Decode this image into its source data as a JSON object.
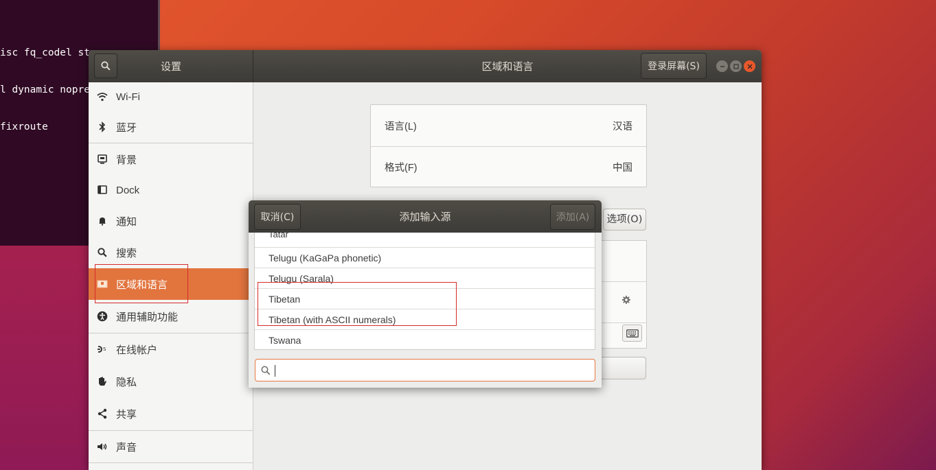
{
  "terminal": {
    "lines": [
      "isc fq_codel st",
      "l dynamic nopre",
      "fixroute"
    ]
  },
  "settings": {
    "sidebar_title": "设置",
    "page_title": "区域和语言",
    "login_screen_button": "登录屏幕(S)",
    "sidebar": {
      "items": [
        {
          "label": "Wi-Fi",
          "icon": "wifi-icon"
        },
        {
          "label": "蓝牙",
          "icon": "bluetooth-icon"
        },
        {
          "label": "背景",
          "icon": "background-icon"
        },
        {
          "label": "Dock",
          "icon": "dock-icon"
        },
        {
          "label": "通知",
          "icon": "bell-icon"
        },
        {
          "label": "搜索",
          "icon": "search-icon"
        },
        {
          "label": "区域和语言",
          "icon": "flag-icon"
        },
        {
          "label": "通用辅助功能",
          "icon": "accessibility-icon"
        },
        {
          "label": "在线帐户",
          "icon": "online-accounts-icon"
        },
        {
          "label": "隐私",
          "icon": "hand-icon"
        },
        {
          "label": "共享",
          "icon": "share-icon"
        },
        {
          "label": "声音",
          "icon": "speaker-icon"
        }
      ],
      "active": "区域和语言"
    },
    "language": {
      "label": "语言(L)",
      "value": "汉语"
    },
    "formats": {
      "label": "格式(F)",
      "value": "中国"
    },
    "options_button": "选项(O)"
  },
  "dialog": {
    "title": "添加输入源",
    "cancel_label": "取消(C)",
    "add_label": "添加(A)",
    "list_items": [
      "Tatar",
      "Telugu (KaGaPa phonetic)",
      "Telugu (Sarala)",
      "Tibetan",
      "Tibetan (with ASCII numerals)",
      "Tswana"
    ],
    "search_value": ""
  },
  "colors": {
    "accent": "#e2743e",
    "highlight": "#d62b2b",
    "titlebar": "#3d3b37"
  }
}
